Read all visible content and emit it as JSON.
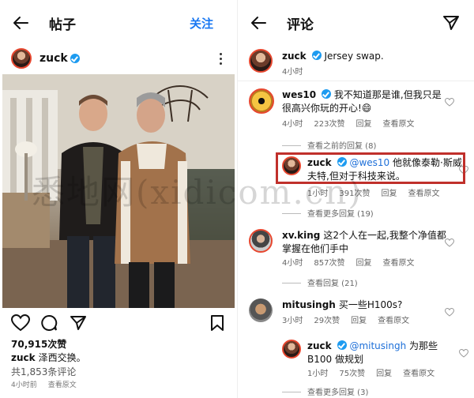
{
  "left": {
    "title": "帖子",
    "follow_label": "关注",
    "username": "zuck",
    "likes": "70,915次赞",
    "caption_user": "zuck",
    "caption_text": "泽西交换。",
    "comment_total": "共1,853条评论",
    "time": "4小时前",
    "translate": "查看原文"
  },
  "right": {
    "title": "评论",
    "post": {
      "user": "zuck",
      "text": "Jersey swap.",
      "time": "4小时"
    },
    "comments": [
      {
        "user": "wes10",
        "text": "我不知道那是谁,但我只是很高兴你玩的开心!😄",
        "time": "4小时",
        "likes": "223次赞",
        "reply": "回复",
        "translate": "查看原文",
        "view_prev": "查看之前的回复 (8)"
      },
      {
        "user": "zuck",
        "mention": "@wes10",
        "text": "他就像泰勒·斯威夫特,但对于科技来说。",
        "time": "1小时",
        "likes": "391次赞",
        "reply": "回复",
        "translate": "查看原文",
        "view_more": "查看更多回复 (19)"
      },
      {
        "user": "xv.king",
        "text": "这2个人在一起,我整个净值都掌握在他们手中",
        "time": "4小时",
        "likes": "857次赞",
        "reply": "回复",
        "translate": "查看原文",
        "view_more": "查看回复 (21)"
      },
      {
        "user": "mitusingh",
        "text": "买一些H100s?",
        "time": "3小时",
        "likes": "29次赞",
        "reply": "回复",
        "translate": "查看原文"
      },
      {
        "user": "zuck",
        "mention": "@mitusingh",
        "text": "为那些B100 做规划",
        "time": "1小时",
        "likes": "75次赞",
        "reply": "回复",
        "translate": "查看原文",
        "view_more": "查看更多回复 (3)"
      }
    ]
  },
  "watermark": "悉地网(xidicom.cn)",
  "colors": {
    "link_blue": "#1877f2",
    "highlight_red": "#c0302b",
    "verified_blue": "#1d9bf0"
  }
}
